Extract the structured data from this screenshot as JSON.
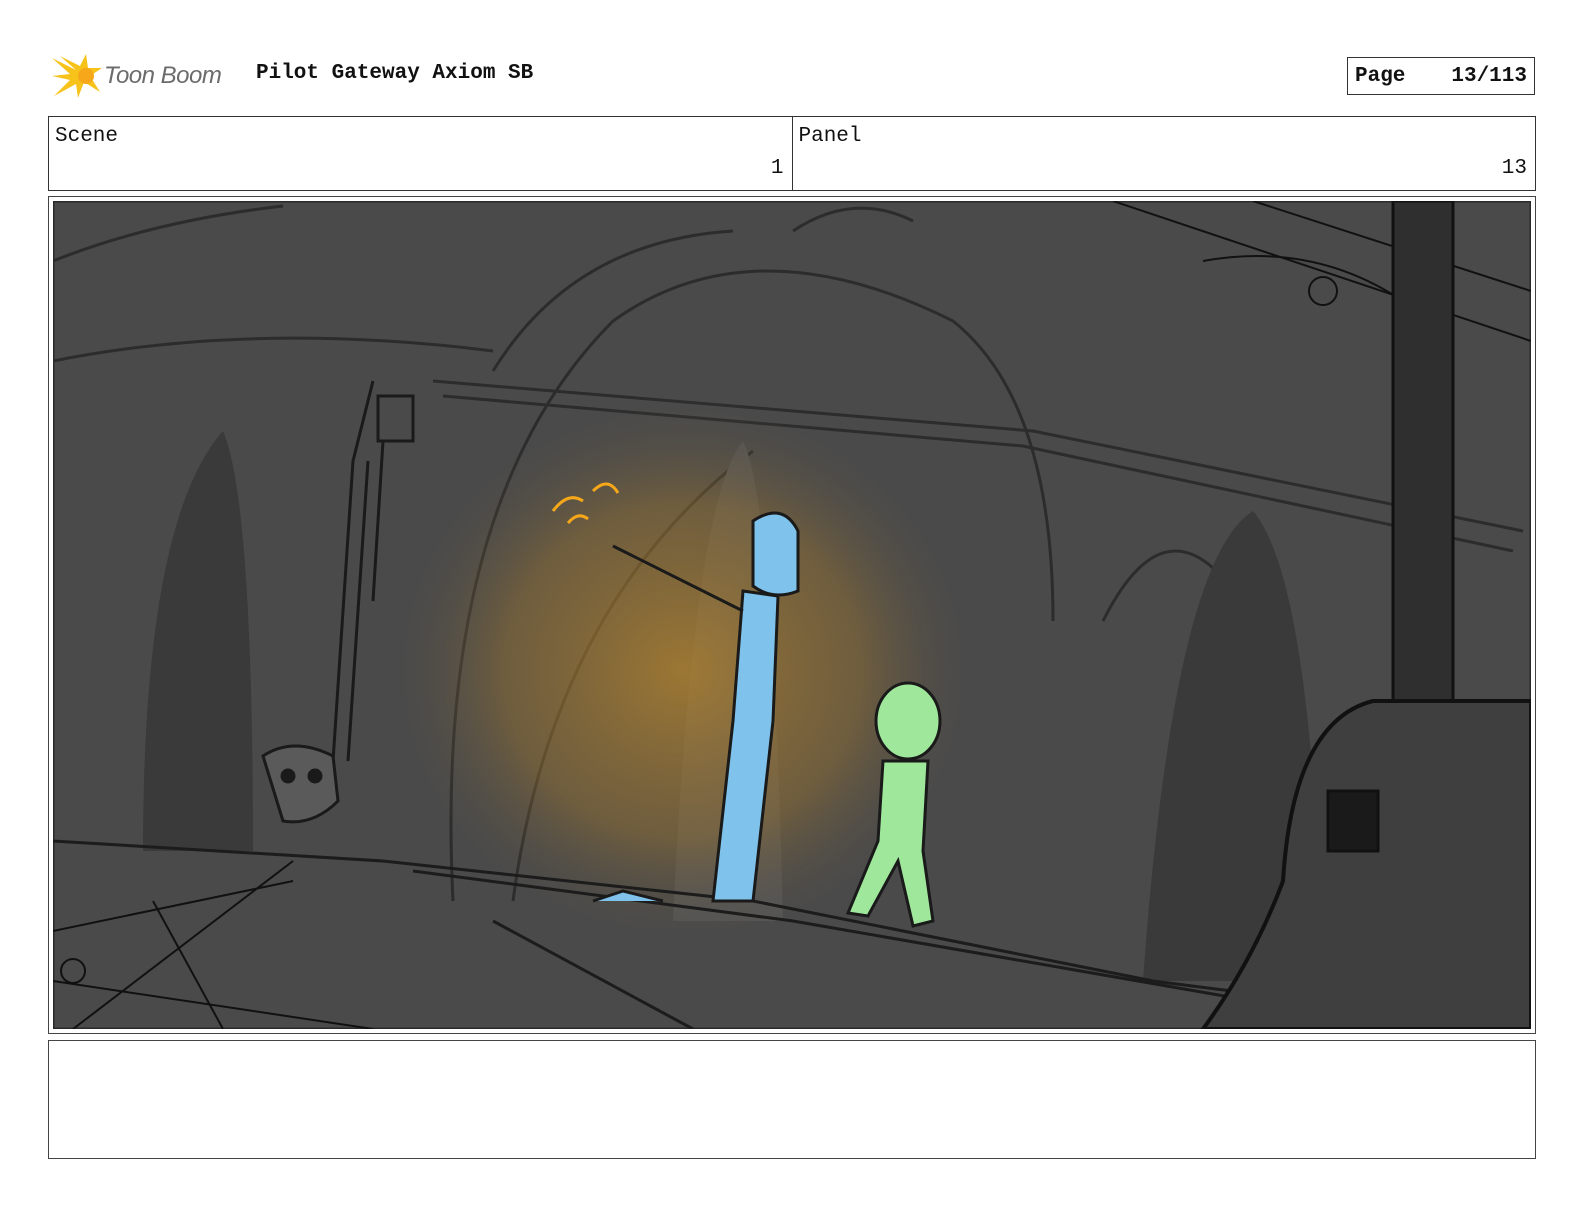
{
  "header": {
    "logo_text": "Toon Boom",
    "project_title": "Pilot Gateway Axiom SB",
    "page_label": "Page",
    "page_number": "13/113"
  },
  "info": {
    "scene_label": "Scene",
    "scene_value": "1",
    "panel_label": "Panel",
    "panel_value": "13"
  },
  "colors": {
    "brand_yellow": "#f7c21a",
    "background_gray": "#4a4a4a",
    "glow_orange": "#b8862c",
    "character_blue": "#7fc3ec",
    "character_green": "#9fe79b"
  },
  "notes": {
    "text": ""
  }
}
